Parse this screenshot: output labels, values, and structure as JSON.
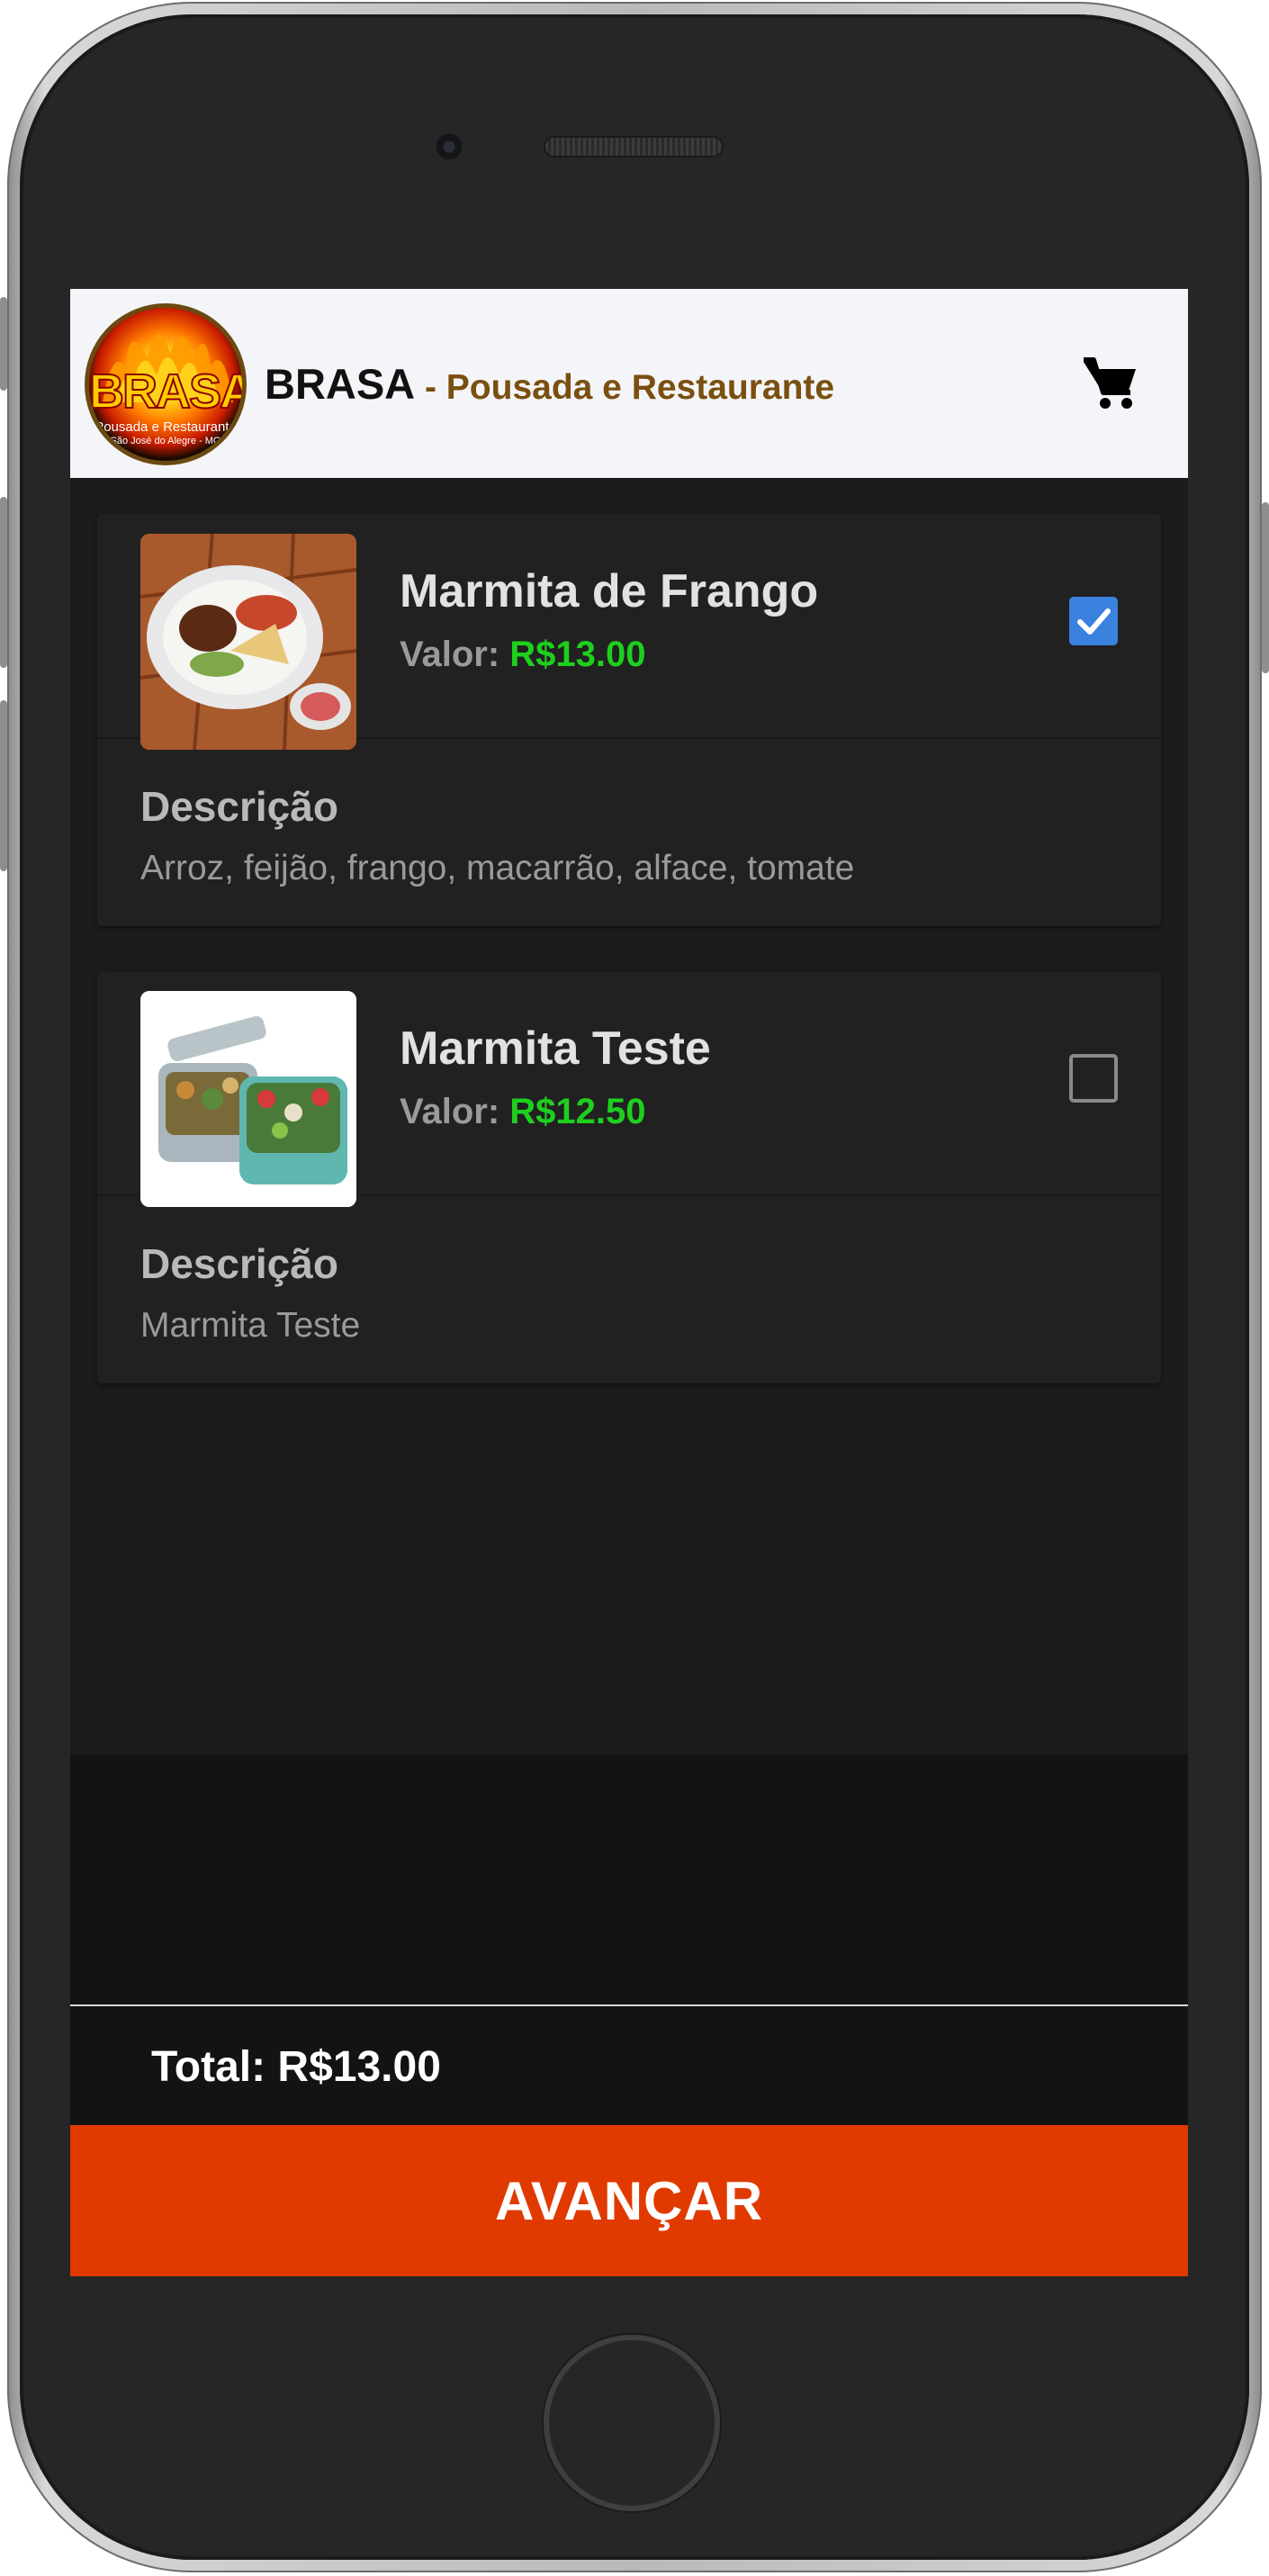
{
  "header": {
    "logo_text": "BRASA",
    "logo_subtext": "Pousada e Restaurante",
    "logo_subtext2": "São José do Alegre - MG",
    "brand_name": "BRASA",
    "brand_subtitle": " - Pousada e Restaurante",
    "cart_icon": "shopping-cart-icon"
  },
  "products": [
    {
      "name": "Marmita de Frango",
      "price_label": "Valor: ",
      "price": "R$13.00",
      "selected": true,
      "desc_title": "Descrição",
      "description": "Arroz, feijão, frango, macarrão, alface, tomate"
    },
    {
      "name": "Marmita Teste",
      "price_label": "Valor: ",
      "price": "R$12.50",
      "selected": false,
      "desc_title": "Descrição",
      "description": "Marmita Teste"
    }
  ],
  "footer": {
    "total": "Total: R$13.00",
    "advance_label": "AVANÇAR"
  },
  "colors": {
    "price": "#1ed01e",
    "checkbox": "#3b82e0",
    "advance_button": "#e03a00",
    "brand_subtitle": "#7a4f10"
  }
}
